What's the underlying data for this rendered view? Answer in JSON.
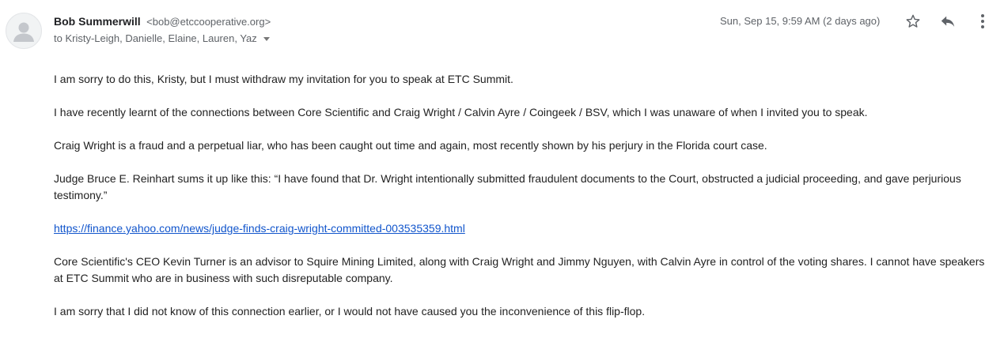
{
  "sender": {
    "name": "Bob Summerwill",
    "email": "<bob@etccooperative.org>",
    "avatar_icon": "person-icon"
  },
  "recipients": {
    "text": "to Kristy-Leigh, Danielle, Elaine, Lauren, Yaz",
    "expand_icon": "caret-down-icon"
  },
  "timestamp": "Sun, Sep 15, 9:59 AM (2 days ago)",
  "actions": {
    "star_icon": "star-icon",
    "reply_icon": "reply-icon",
    "more_icon": "more-vertical-icon"
  },
  "message": {
    "p1": "I am sorry to do this, Kristy, but I must withdraw my invitation for you to speak at ETC Summit.",
    "p2": "I have recently learnt of the connections between Core Scientific and Craig Wright / Calvin Ayre / Coingeek / BSV, which I was unaware of when I invited you to speak.",
    "p3": "Craig Wright is a fraud and a perpetual liar, who has been caught out time and again, most recently shown by his perjury in the Florida court case.",
    "p4": "Judge Bruce E. Reinhart sums it up like this: “I have found that Dr. Wright intentionally submitted fraudulent documents to the Court, obstructed a judicial proceeding, and gave perjurious testimony.”",
    "link": "https://finance.yahoo.com/news/judge-finds-craig-wright-committed-003535359.html",
    "p5": "Core Scientific's CEO Kevin Turner is an advisor to Squire Mining Limited, along with Craig Wright and Jimmy Nguyen, with Calvin Ayre in control of the voting shares.  I cannot have speakers at ETC Summit who are in business with such disreputable company.",
    "p6": "I am sorry that I did not know of this connection earlier, or I would not have caused you the inconvenience of this flip-flop."
  },
  "colors": {
    "link": "#1155cc",
    "secondary_text": "#5f6368",
    "body_text": "#222222"
  }
}
